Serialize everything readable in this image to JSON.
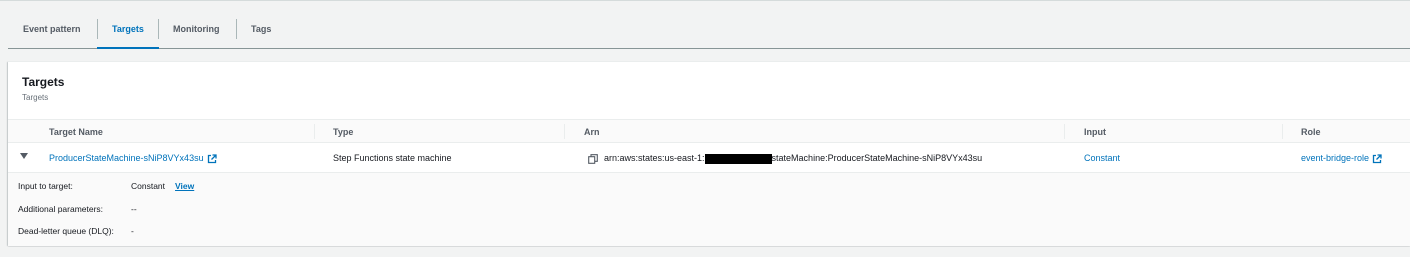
{
  "tabs": [
    {
      "label": "Event pattern"
    },
    {
      "label": "Targets"
    },
    {
      "label": "Monitoring"
    },
    {
      "label": "Tags"
    }
  ],
  "active_tab": "Targets",
  "panel": {
    "title": "Targets",
    "description": "Targets"
  },
  "table": {
    "columns": [
      "Target Name",
      "Type",
      "Arn",
      "Input",
      "Role"
    ],
    "row": {
      "target_name": "ProducerStateMachine-sNiP8VYx43su",
      "type": "Step Functions state machine",
      "arn_prefix": "arn:aws:states:us-east-1:",
      "arn_suffix": "stateMachine:ProducerStateMachine-sNiP8VYx43su",
      "input": "Constant",
      "role": "event-bridge-role"
    }
  },
  "details": {
    "input_label": "Input to target:",
    "input_value": "Constant",
    "input_view": "View",
    "params_label": "Additional parameters:",
    "params_value": "--",
    "dlq_label": "Dead-letter queue (DLQ):",
    "dlq_value": "-"
  },
  "colors": {
    "link": "#0073bb",
    "background": "#f2f3f3"
  },
  "icons": {
    "expand": "caret-down-icon",
    "external": "external-link-icon",
    "copy": "copy-icon"
  }
}
